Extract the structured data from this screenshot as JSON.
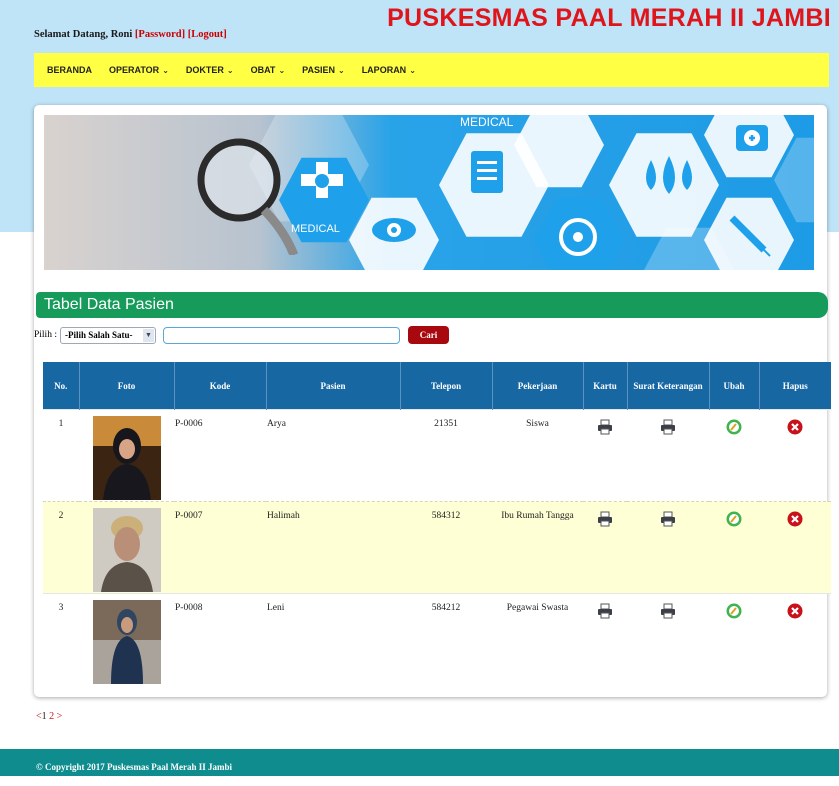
{
  "header": {
    "welcome_text": "Selamat Datang, Roni",
    "password_link": "[Password]",
    "logout_link": "[Logout]",
    "site_title": "PUSKESMAS PAAL MERAH II JAMBI"
  },
  "nav": [
    {
      "label": "BERANDA",
      "has_menu": false
    },
    {
      "label": "OPERATOR",
      "has_menu": true
    },
    {
      "label": "DOKTER",
      "has_menu": true
    },
    {
      "label": "OBAT",
      "has_menu": true
    },
    {
      "label": "PASIEN",
      "has_menu": true
    },
    {
      "label": "LAPORAN",
      "has_menu": true
    }
  ],
  "banner": {
    "word_1": "MEDICAL",
    "word_2": "MEDICAL"
  },
  "section_title": "Tabel Data Pasien",
  "search": {
    "label": "Pilih :",
    "select_value": "-Pilih Salah Satu-",
    "input_value": "",
    "button_label": "Cari"
  },
  "table": {
    "headers": [
      "No.",
      "Foto",
      "Kode",
      "Pasien",
      "Telepon",
      "Pekerjaan",
      "Kartu",
      "Surat Keterangan",
      "Ubah",
      "Hapus"
    ],
    "rows": [
      {
        "no": "1",
        "kode": "P-0006",
        "pasien": "Arya",
        "telepon": "21351",
        "pekerjaan": "Siswa"
      },
      {
        "no": "2",
        "kode": "P-0007",
        "pasien": "Halimah",
        "telepon": "584312",
        "pekerjaan": "Ibu Rumah Tangga"
      },
      {
        "no": "3",
        "kode": "P-0008",
        "pasien": "Leni",
        "telepon": "584212",
        "pekerjaan": "Pegawai Swasta"
      }
    ]
  },
  "pagination": {
    "prev": "<",
    "page_1": "1",
    "page_2": "2",
    "next": ">"
  },
  "footer": "© Copyright 2017 Puskesmas Paal Merah II Jambi",
  "colors": {
    "title_red": "#e0151b",
    "nav_yellow": "#ffff44",
    "section_green": "#169b5a",
    "table_header_blue": "#1767a3",
    "button_red": "#a8090f",
    "footer_teal": "#0f8d8e"
  }
}
